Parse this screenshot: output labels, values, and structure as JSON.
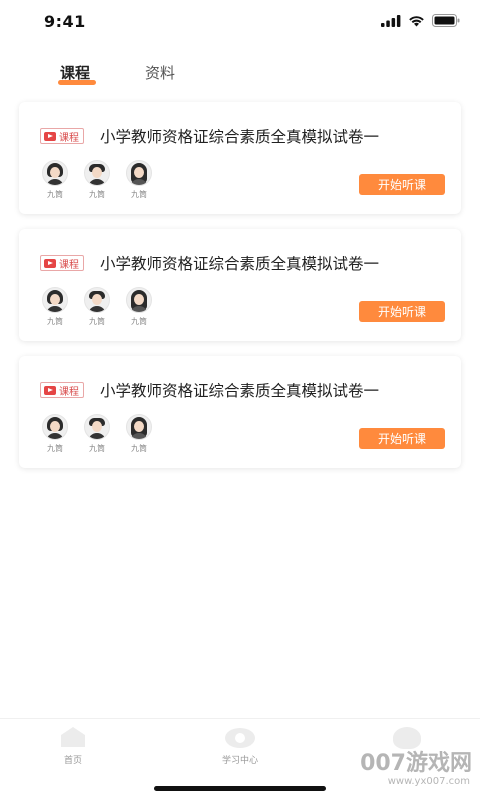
{
  "status_bar": {
    "time": "9:41"
  },
  "tabs": [
    {
      "label": "课程",
      "active": true
    },
    {
      "label": "资料",
      "active": false
    }
  ],
  "cards": [
    {
      "tag": "课程",
      "title": "小学教师资格证综合素质全真模拟试卷一",
      "teachers": [
        {
          "name": "九筒"
        },
        {
          "name": "九筒"
        },
        {
          "name": "九筒"
        }
      ],
      "button": "开始听课"
    },
    {
      "tag": "课程",
      "title": "小学教师资格证综合素质全真模拟试卷一",
      "teachers": [
        {
          "name": "九筒"
        },
        {
          "name": "九筒"
        },
        {
          "name": "九筒"
        }
      ],
      "button": "开始听课"
    },
    {
      "tag": "课程",
      "title": "小学教师资格证综合素质全真模拟试卷一",
      "teachers": [
        {
          "name": "九筒"
        },
        {
          "name": "九筒"
        },
        {
          "name": "九筒"
        }
      ],
      "button": "开始听课"
    }
  ],
  "bottom_nav": [
    {
      "label": "首页",
      "icon": "home-icon"
    },
    {
      "label": "学习中心",
      "icon": "eye-icon"
    },
    {
      "label": "",
      "icon": "user-icon"
    }
  ],
  "watermark": {
    "text": "007游戏网",
    "url": "www.yx007.com"
  },
  "colors": {
    "accent": "#ff8a3d",
    "tag_red": "#d84b4b"
  }
}
